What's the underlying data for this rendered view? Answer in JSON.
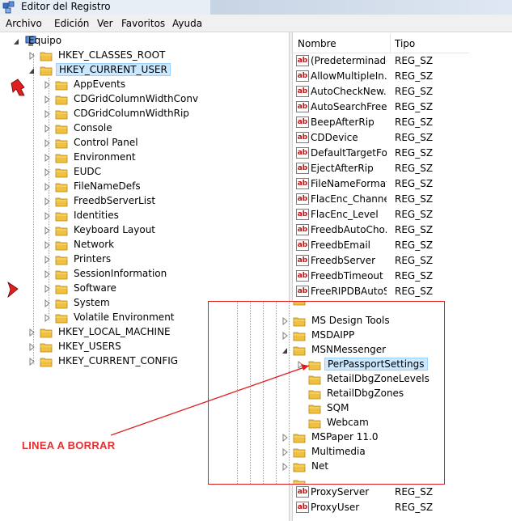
{
  "window": {
    "title": "Editor del Registro"
  },
  "menu": [
    "Archivo",
    "Edición",
    "Ver",
    "Favoritos",
    "Ayuda"
  ],
  "tree": {
    "root": "Equipo",
    "hives": [
      "HKEY_CLASSES_ROOT",
      "HKEY_CURRENT_USER",
      "HKEY_LOCAL_MACHINE",
      "HKEY_USERS",
      "HKEY_CURRENT_CONFIG"
    ],
    "current_user_children": [
      "AppEvents",
      "CDGridColumnWidthConv",
      "CDGridColumnWidthRip",
      "Console",
      "Control Panel",
      "Environment",
      "EUDC",
      "FileNameDefs",
      "FreedbServerList",
      "Identities",
      "Keyboard Layout",
      "Network",
      "Printers",
      "SessionInformation",
      "Software",
      "System",
      "Volatile Environment"
    ]
  },
  "list": {
    "columns": [
      "Nombre",
      "Tipo"
    ],
    "rows": [
      {
        "name": "(Predeterminado)",
        "type": "REG_SZ"
      },
      {
        "name": "AllowMultipleIn...",
        "type": "REG_SZ"
      },
      {
        "name": "AutoCheckNew...",
        "type": "REG_SZ"
      },
      {
        "name": "AutoSearchFree...",
        "type": "REG_SZ"
      },
      {
        "name": "BeepAfterRip",
        "type": "REG_SZ"
      },
      {
        "name": "CDDevice",
        "type": "REG_SZ"
      },
      {
        "name": "DefaultTargetFo...",
        "type": "REG_SZ"
      },
      {
        "name": "EjectAfterRip",
        "type": "REG_SZ"
      },
      {
        "name": "FileNameFormat",
        "type": "REG_SZ"
      },
      {
        "name": "FlacEnc_Channels",
        "type": "REG_SZ"
      },
      {
        "name": "FlacEnc_Level",
        "type": "REG_SZ"
      },
      {
        "name": "FreedbAutoCho...",
        "type": "REG_SZ"
      },
      {
        "name": "FreedbEmail",
        "type": "REG_SZ"
      },
      {
        "name": "FreedbServer",
        "type": "REG_SZ"
      },
      {
        "name": "FreedbTimeout",
        "type": "REG_SZ"
      },
      {
        "name": "FreeRIPDBAutoS...",
        "type": "REG_SZ"
      }
    ],
    "bottom_rows": [
      {
        "name": "ProxyServer",
        "type": "REG_SZ"
      },
      {
        "name": "ProxyUser",
        "type": "REG_SZ"
      }
    ]
  },
  "overlay": {
    "items": [
      {
        "label": "MS Design Tools"
      },
      {
        "label": "MSDAIPP"
      },
      {
        "label": "MSNMessenger"
      },
      {
        "label": "PerPassportSettings"
      },
      {
        "label": "RetailDbgZoneLevels"
      },
      {
        "label": "RetailDbgZones"
      },
      {
        "label": "SQM"
      },
      {
        "label": "Webcam"
      },
      {
        "label": "MSPaper 11.0"
      },
      {
        "label": "Multimedia"
      },
      {
        "label": "Net"
      }
    ]
  },
  "annotation": {
    "text": "LINEA A BORRAR",
    "color": "#e03030"
  },
  "colors": {
    "selection": "#cce8ff",
    "folder": "#f0c040",
    "annotation_box": "#e02020"
  }
}
